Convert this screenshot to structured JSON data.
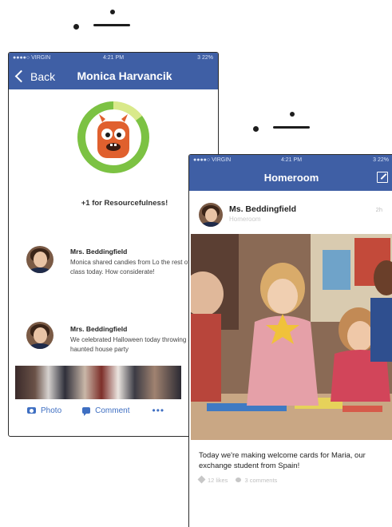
{
  "phone1": {
    "status": {
      "carrier": "●●●●○ VIRGIN",
      "time": "4:21 PM",
      "battery": "3 22%"
    },
    "nav": {
      "back_label": "Back",
      "title": "Monica Harvancik"
    },
    "award_text": "+1 for Resourcefulness!",
    "feed": [
      {
        "name": "Mrs. Beddingfield",
        "body": "Monica shared candies from Lo the rest of the class today. How considerate!"
      },
      {
        "name": "Mrs. Beddingfield",
        "body": "We celebrated Halloween today throwing a haunted house party"
      }
    ],
    "toolbar": {
      "photo_label": "Photo",
      "comment_label": "Comment",
      "more_label": "•••"
    }
  },
  "phone2": {
    "status": {
      "carrier": "●●●●○ VIRGIN",
      "time": "4:21 PM",
      "battery": "3 22%"
    },
    "nav": {
      "title": "Homeroom"
    },
    "post": {
      "author": "Ms. Beddingfield",
      "subtitle": "Homeroom",
      "time": "2h",
      "text": "Today we're making welcome cards for Maria, our exchange student from Spain!",
      "likes": "12 likes",
      "comments": "3 comments"
    }
  },
  "colors": {
    "nav_blue": "#3f5fa5",
    "accent_blue": "#3f6fc2",
    "monster_orange": "#e0602e",
    "ring_green": "#7cc243"
  }
}
